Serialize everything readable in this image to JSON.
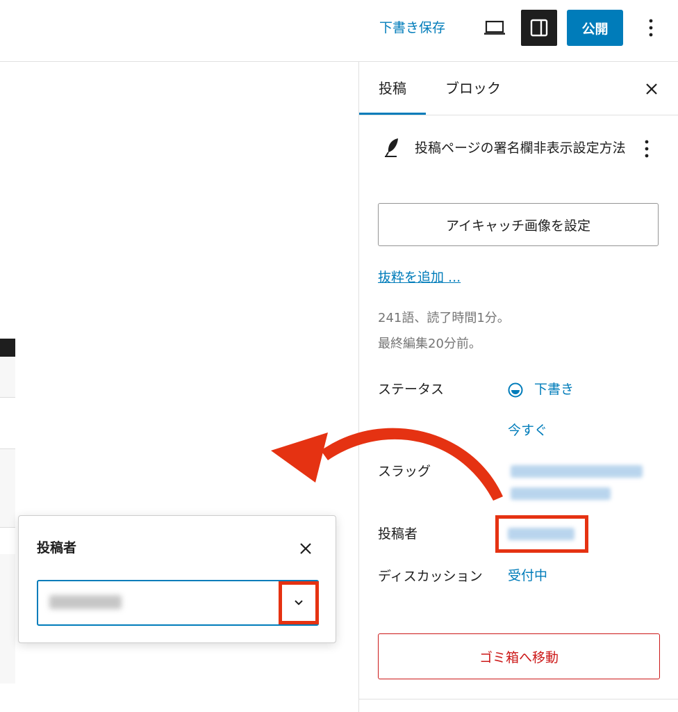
{
  "topbar": {
    "draft_save_label": "下書き保存",
    "preview_icon": "laptop-icon",
    "sidebar_toggle_icon": "sidebar-icon",
    "publish_label": "公開",
    "more_icon": "vertical-ellipsis-icon"
  },
  "sidebar": {
    "tabs": [
      {
        "label": "投稿",
        "active": true
      },
      {
        "label": "ブロック",
        "active": false
      }
    ],
    "close_icon": "close-icon",
    "post": {
      "icon": "quill-icon",
      "title": "投稿ページの署名欄非表示設定方法",
      "more_icon": "vertical-ellipsis-icon"
    },
    "featured_image_label": "アイキャッチ画像を設定",
    "excerpt_link": "抜粋を追加 ...",
    "meta": {
      "word_count": "241語、読了時間1分。",
      "last_edited": "最終編集20分前。"
    },
    "rows": {
      "status_label": "ステータス",
      "status_value": "下書き",
      "publish_value": "今すぐ",
      "slug_label": "スラッグ",
      "author_label": "投稿者",
      "discussion_label": "ディスカッション",
      "discussion_value": "受付中"
    },
    "trash_label": "ゴミ箱へ移動"
  },
  "popover": {
    "title": "投稿者",
    "close_icon": "close-icon",
    "chevron_icon": "chevron-down-icon"
  },
  "colors": {
    "accent": "#007cba",
    "highlight": "#e53212",
    "danger": "#cc1818"
  }
}
